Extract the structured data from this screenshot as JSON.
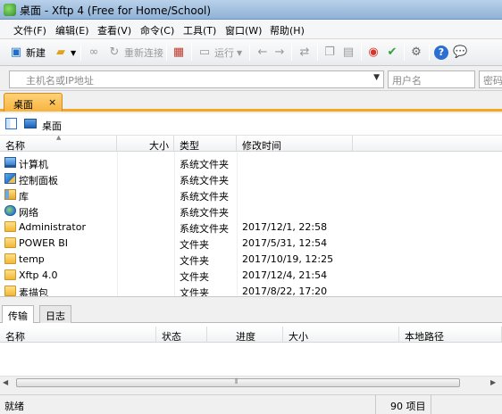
{
  "window": {
    "title": "桌面 - Xftp 4 (Free for Home/School)"
  },
  "menu": [
    "文件(F)",
    "编辑(E)",
    "查看(V)",
    "命令(C)",
    "工具(T)",
    "窗口(W)",
    "帮助(H)"
  ],
  "toolbar": {
    "new_label": "新建",
    "reconnect_label": "重新连接",
    "run_label": "运行"
  },
  "address": {
    "host_placeholder": "主机名或IP地址",
    "user_placeholder": "用户名",
    "pass_placeholder": "密码"
  },
  "session_tab": {
    "label": "桌面",
    "close": "×"
  },
  "path": {
    "current": "桌面"
  },
  "file_list": {
    "columns": {
      "name": "名称",
      "size": "大小",
      "type": "类型",
      "modified": "修改时间"
    },
    "rows": [
      {
        "icon": "computer-icon",
        "name": "计算机",
        "size": "",
        "type": "系统文件夹",
        "modified": ""
      },
      {
        "icon": "control-panel-icon",
        "name": "控制面板",
        "size": "",
        "type": "系统文件夹",
        "modified": ""
      },
      {
        "icon": "library-icon",
        "name": "库",
        "size": "",
        "type": "系统文件夹",
        "modified": ""
      },
      {
        "icon": "network-icon",
        "name": "网络",
        "size": "",
        "type": "系统文件夹",
        "modified": ""
      },
      {
        "icon": "user-folder-icon",
        "name": "Administrator",
        "size": "",
        "type": "系统文件夹",
        "modified": "2017/12/1, 22:58"
      },
      {
        "icon": "folder-icon",
        "name": "POWER BI",
        "size": "",
        "type": "文件夹",
        "modified": "2017/5/31, 12:54"
      },
      {
        "icon": "folder-icon",
        "name": "temp",
        "size": "",
        "type": "文件夹",
        "modified": "2017/10/19, 12:25"
      },
      {
        "icon": "folder-icon",
        "name": "Xftp 4.0",
        "size": "",
        "type": "文件夹",
        "modified": "2017/12/4, 21:54"
      },
      {
        "icon": "folder-icon",
        "name": "素描包",
        "size": "",
        "type": "文件夹",
        "modified": "2017/8/22, 17:20"
      }
    ]
  },
  "bottom_tabs": [
    "传输",
    "日志"
  ],
  "transfer": {
    "columns": {
      "name": "名称",
      "status": "状态",
      "progress": "进度",
      "size": "大小",
      "local_path": "本地路径"
    }
  },
  "status": {
    "text": "就绪",
    "count": "90 项目"
  },
  "colors": {
    "tab_accent": "#f5a623",
    "titlebar": "#b9d1ea"
  }
}
